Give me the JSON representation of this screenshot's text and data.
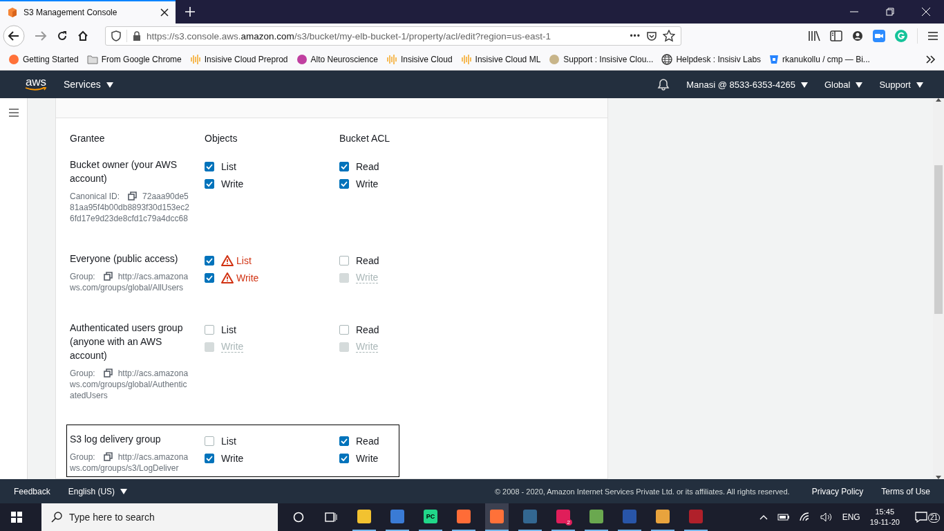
{
  "browser": {
    "tab_title": "S3 Management Console",
    "url": {
      "prefix": "https://s3.console.aws.",
      "domain": "amazon.com",
      "path": "/s3/bucket/my-elb-bucket-1/property/acl/edit?region=us-east-1"
    },
    "page_actions": "•••",
    "bookmarks": [
      {
        "kind": "firefox",
        "label": "Getting Started"
      },
      {
        "kind": "folder",
        "label": "From Google Chrome"
      },
      {
        "kind": "bars",
        "label": "Insisive Cloud Preprod"
      },
      {
        "kind": "swirl",
        "label": "Alto Neuroscience"
      },
      {
        "kind": "bars",
        "label": "Insisive Cloud"
      },
      {
        "kind": "bars",
        "label": "Insisive Cloud ML"
      },
      {
        "kind": "blur",
        "label": "Support : Insisive Clou..."
      },
      {
        "kind": "globe",
        "label": "Helpdesk : Insisiv Labs"
      },
      {
        "kind": "bucket",
        "label": "rkanukollu / cmp — Bi..."
      }
    ]
  },
  "aws_header": {
    "logo": "aws",
    "services": "Services",
    "account": "Manasi @ 8533-6353-4265",
    "region": "Global",
    "support": "Support"
  },
  "acl": {
    "columns": [
      "Grantee",
      "Objects",
      "Bucket ACL"
    ],
    "grantees": [
      {
        "name": "Bucket owner (your AWS account)",
        "id_label": "Canonical ID:",
        "id_value": "72aaa90de581aa95f4b00db8893f30d153ec26fd17e9d23de8cfd1c79a4dcc68",
        "selected": false,
        "objects": [
          {
            "label": "List",
            "checked": true,
            "disabled": false,
            "warning": false
          },
          {
            "label": "Write",
            "checked": true,
            "disabled": false,
            "warning": false
          }
        ],
        "bucket_acl": [
          {
            "label": "Read",
            "checked": true,
            "disabled": false,
            "warning": false
          },
          {
            "label": "Write",
            "checked": true,
            "disabled": false,
            "warning": false
          }
        ]
      },
      {
        "name": "Everyone (public access)",
        "id_label": "Group:",
        "id_value": "http://acs.amazonaws.com/groups/global/AllUsers",
        "selected": false,
        "objects": [
          {
            "label": "List",
            "checked": true,
            "disabled": false,
            "warning": true
          },
          {
            "label": "Write",
            "checked": true,
            "disabled": false,
            "warning": true
          }
        ],
        "bucket_acl": [
          {
            "label": "Read",
            "checked": false,
            "disabled": false,
            "warning": false
          },
          {
            "label": "Write",
            "checked": false,
            "disabled": true,
            "warning": false
          }
        ]
      },
      {
        "name": "Authenticated users group (anyone with an AWS account)",
        "id_label": "Group:",
        "id_value": "http://acs.amazonaws.com/groups/global/AuthenticatedUsers",
        "selected": false,
        "objects": [
          {
            "label": "List",
            "checked": false,
            "disabled": false,
            "warning": false
          },
          {
            "label": "Write",
            "checked": false,
            "disabled": true,
            "warning": false
          }
        ],
        "bucket_acl": [
          {
            "label": "Read",
            "checked": false,
            "disabled": false,
            "warning": false
          },
          {
            "label": "Write",
            "checked": false,
            "disabled": true,
            "warning": false
          }
        ]
      },
      {
        "name": "S3 log delivery group",
        "id_label": "Group:",
        "id_value": "http://acs.amazonaws.com/groups/s3/LogDeliver",
        "selected": true,
        "objects": [
          {
            "label": "List",
            "checked": false,
            "disabled": false,
            "warning": false
          },
          {
            "label": "Write",
            "checked": true,
            "disabled": false,
            "warning": false
          }
        ],
        "bucket_acl": [
          {
            "label": "Read",
            "checked": true,
            "disabled": false,
            "warning": false
          },
          {
            "label": "Write",
            "checked": true,
            "disabled": false,
            "warning": false
          }
        ]
      }
    ]
  },
  "footer": {
    "feedback": "Feedback",
    "language": "English (US)",
    "copyright": "© 2008 - 2020, Amazon Internet Services Private Ltd. or its affiliates. All rights reserved.",
    "privacy": "Privacy Policy",
    "terms": "Terms of Use"
  },
  "taskbar": {
    "search_placeholder": "Type here to search",
    "apps": [
      {
        "kind": "files",
        "active": false
      },
      {
        "kind": "lock",
        "active": false
      },
      {
        "kind": "pycharm",
        "active": false,
        "text": "PC"
      },
      {
        "kind": "postman",
        "active": false
      },
      {
        "kind": "firefox",
        "active": true
      },
      {
        "kind": "pgadmin",
        "active": false
      },
      {
        "kind": "slack",
        "active": false,
        "badge": "2"
      },
      {
        "kind": "notepad",
        "active": false
      },
      {
        "kind": "network",
        "active": false
      },
      {
        "kind": "paint",
        "active": false
      },
      {
        "kind": "tool",
        "active": false
      }
    ],
    "language": "ENG",
    "time": "15:45",
    "date": "19-11-20",
    "notifications": "21"
  }
}
